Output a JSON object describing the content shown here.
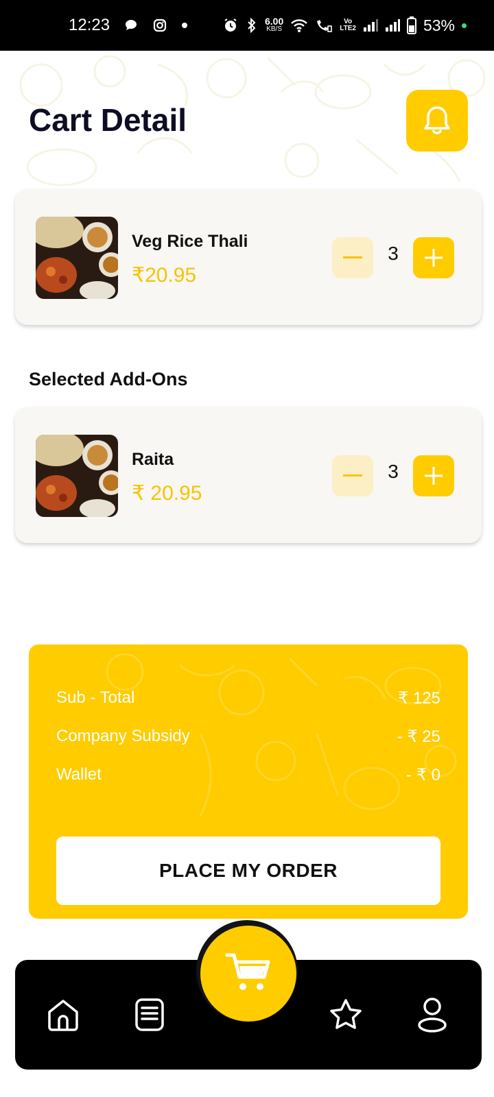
{
  "status_bar": {
    "time": "12:23",
    "net_speed_value": "6.00",
    "net_speed_unit": "KB/S",
    "volte_top": "Vo",
    "volte_bottom": "LTE2",
    "battery": "53%"
  },
  "header": {
    "title": "Cart Detail",
    "bell_icon": "bell-icon"
  },
  "cart_item": {
    "name": "Veg Rice Thali",
    "price": "₹20.95",
    "quantity": "3"
  },
  "addons": {
    "section_title": "Selected Add-Ons",
    "items": [
      {
        "name": "Raita",
        "price": "₹ 20.95",
        "quantity": "3"
      }
    ]
  },
  "summary": {
    "rows": [
      {
        "label": "Sub - Total",
        "value": "₹ 125"
      },
      {
        "label": "Company Subsidy",
        "value": "- ₹ 25"
      },
      {
        "label": "Wallet",
        "value": "- ₹ 0"
      }
    ],
    "button_label": "PLACE MY ORDER"
  },
  "bottom_nav": {
    "items": [
      "home-icon",
      "menu-icon",
      "cart-icon",
      "star-icon",
      "profile-icon"
    ]
  },
  "colors": {
    "accent": "#ffcc00",
    "minus_bg": "#fcefc6",
    "nav_bg": "#000000",
    "title": "#0d0d26"
  }
}
